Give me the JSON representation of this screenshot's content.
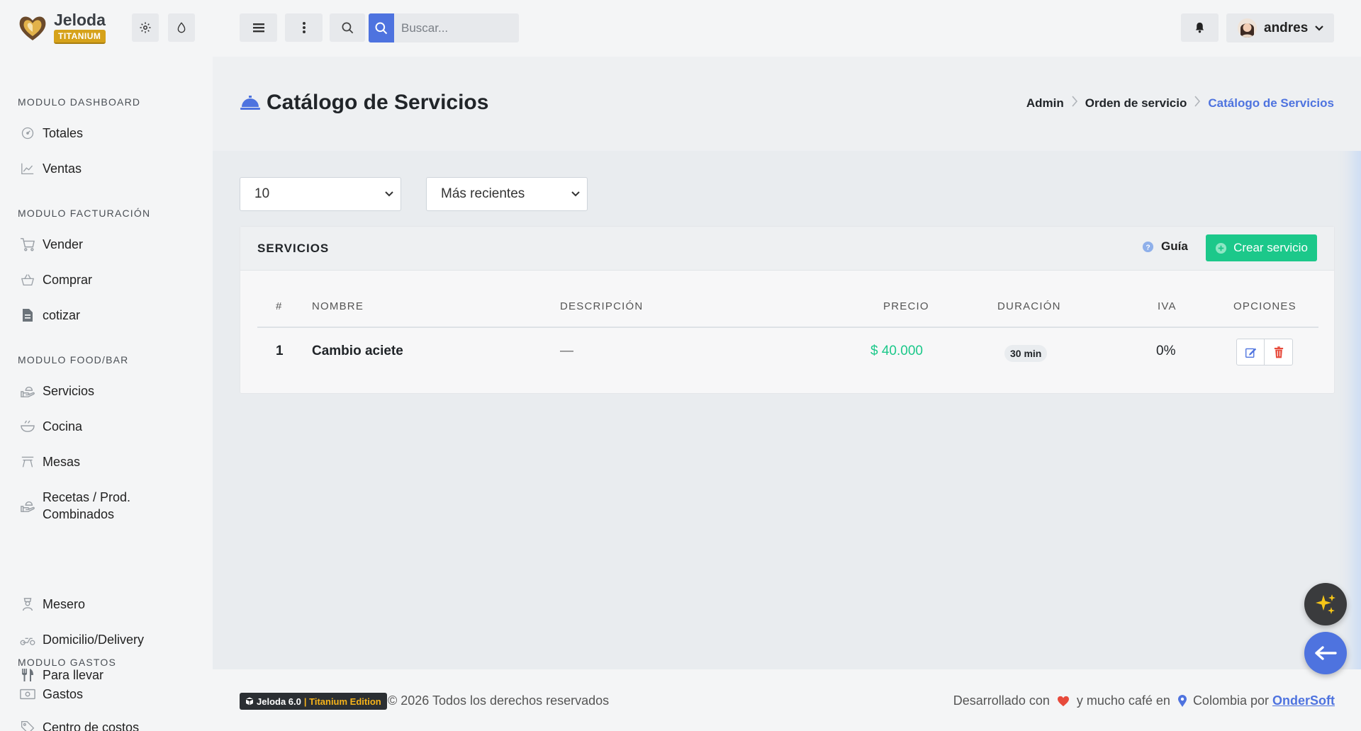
{
  "brand": {
    "name": "Jeloda",
    "edition_badge": "TITANIUM"
  },
  "search": {
    "placeholder": "Buscar..."
  },
  "user": {
    "name": "andres"
  },
  "sidebar": {
    "sections": [
      {
        "title": "MODULO DASHBOARD"
      },
      {
        "title": "MODULO FACTURACIÓN"
      },
      {
        "title": "MODULO FOOD/BAR"
      },
      {
        "title": "MODULO GASTOS"
      }
    ],
    "items": [
      {
        "label": "Totales",
        "icon": "gauge-icon"
      },
      {
        "label": "Ventas",
        "icon": "chart-line-icon"
      },
      {
        "label": "Vender",
        "icon": "cart-icon"
      },
      {
        "label": "Comprar",
        "icon": "basket-icon"
      },
      {
        "label": "cotizar",
        "icon": "file-invoice-icon"
      },
      {
        "label": "Servicios",
        "icon": "hand-tray-icon"
      },
      {
        "label": "Cocina",
        "icon": "bowl-icon"
      },
      {
        "label": "Mesas",
        "icon": "table-icon"
      },
      {
        "label": "Recetas / Prod. Combinados",
        "icon": "hand-tray-icon"
      },
      {
        "label": "Mesero",
        "icon": "waiter-icon"
      },
      {
        "label": "Domicilio/Delivery",
        "icon": "motorcycle-icon"
      },
      {
        "label": "Para llevar",
        "icon": "utensils-icon"
      },
      {
        "label": "Gastos",
        "icon": "money-icon"
      },
      {
        "label": "Centro de costos",
        "icon": "tag-icon"
      }
    ]
  },
  "page": {
    "title": "Catálogo de Servicios",
    "title_icon": "concierge-bell-icon"
  },
  "breadcrumb": [
    "Admin",
    "Orden de servicio",
    "Catálogo de Servicios"
  ],
  "filters": {
    "per_page": "10",
    "order": "Más recientes"
  },
  "card": {
    "title": "SERVICIOS",
    "guide_label": "Guía",
    "create_label": "Crear servicio"
  },
  "table": {
    "headers": [
      "#",
      "NOMBRE",
      "DESCRIPCIÓN",
      "PRECIO",
      "DURACIÓN",
      "IVA",
      "OPCIONES"
    ],
    "rows": [
      {
        "num": "1",
        "name": "Cambio aciete",
        "description": "—",
        "price": "$ 40.000",
        "duration": "30 min",
        "iva": "0%"
      }
    ]
  },
  "footer": {
    "badge_version": "Jeloda 6.0",
    "badge_edition": "| Titanium Edition",
    "copyright": "© 2026 Todos los derechos reservados",
    "dev_text1": "Desarrollado con",
    "dev_text2": "y mucho café en",
    "dev_text3": "Colombia por",
    "company": "OnderSoft"
  },
  "colors": {
    "primary": "#4e73df",
    "success": "#1cc88a",
    "badge_gold": "#d6a21a",
    "danger": "#e74a3b",
    "fab_dark": "#3a3b3d"
  }
}
